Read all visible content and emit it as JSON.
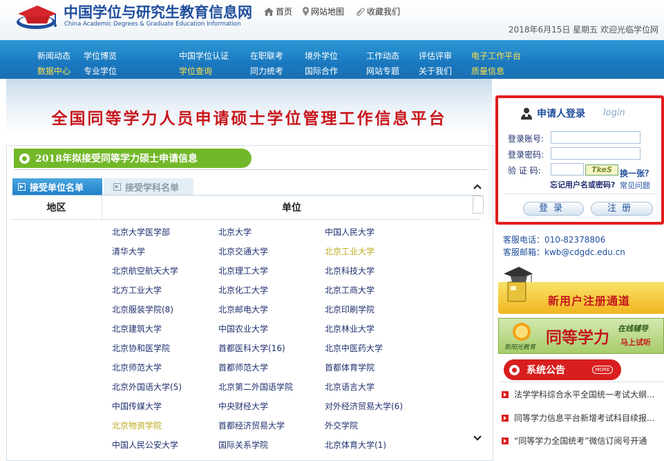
{
  "header": {
    "logo_cn": "中国学位与研究生教育信息网",
    "logo_en": "China Academic Degrees & Graduate Education Information",
    "links": [
      {
        "icon": "home-icon",
        "label": "首页"
      },
      {
        "icon": "location-pin-icon",
        "label": "网站地图"
      },
      {
        "icon": "paperclip-icon",
        "label": "收藏我们"
      }
    ],
    "date_text": "2018年6月15日  星期五  欢迎光临学位网"
  },
  "nav": {
    "row1": [
      "新闻动态",
      "学位博览",
      "中国学位认证",
      "在职联考",
      "境外学位",
      "工作动态",
      "评估评审",
      "电子工作平台"
    ],
    "row2": [
      "数据中心",
      "专业学位",
      "学位查询",
      "同力统考",
      "国际合作",
      "网站专题",
      "关于我们",
      "质量信息"
    ],
    "highlight_color": "#ffe14a"
  },
  "banner": {
    "title": "全国同等学力人员申请硕士学位管理工作信息平台"
  },
  "section": {
    "title": "2018年拟接受同等学力硕士申请信息",
    "tabs": [
      "接受单位名单",
      "接受学科名单"
    ],
    "table_headers": [
      "地区",
      "单位"
    ],
    "rows": [
      [
        {
          "t": "北京大学医学部"
        },
        {
          "t": "北京大学"
        },
        {
          "t": "中国人民大学"
        }
      ],
      [
        {
          "t": "清华大学"
        },
        {
          "t": "北京交通大学"
        },
        {
          "t": "北京工业大学",
          "hl": true
        }
      ],
      [
        {
          "t": "北京航空航天大学"
        },
        {
          "t": "北京理工大学"
        },
        {
          "t": "北京科技大学"
        }
      ],
      [
        {
          "t": "北方工业大学"
        },
        {
          "t": "北京化工大学"
        },
        {
          "t": "北京工商大学"
        }
      ],
      [
        {
          "t": "北京服装学院(8)"
        },
        {
          "t": "北京邮电大学"
        },
        {
          "t": "北京印刷学院"
        }
      ],
      [
        {
          "t": "北京建筑大学"
        },
        {
          "t": "中国农业大学"
        },
        {
          "t": "北京林业大学"
        }
      ],
      [
        {
          "t": "北京协和医学院"
        },
        {
          "t": "首都医科大学(16)"
        },
        {
          "t": "北京中医药大学"
        }
      ],
      [
        {
          "t": "北京师范大学"
        },
        {
          "t": "首都师范大学"
        },
        {
          "t": "首都体育学院"
        }
      ],
      [
        {
          "t": "北京外国语大学(5)"
        },
        {
          "t": "北京第二外国语学院"
        },
        {
          "t": "北京语言大学"
        }
      ],
      [
        {
          "t": "中国传媒大学"
        },
        {
          "t": "中央财经大学"
        },
        {
          "t": "对外经济贸易大学(6)"
        }
      ],
      [
        {
          "t": "北京物资学院",
          "hl": true
        },
        {
          "t": "首都经济贸易大学"
        },
        {
          "t": "外交学院"
        }
      ],
      [
        {
          "t": "中国人民公安大学"
        },
        {
          "t": "国际关系学院"
        },
        {
          "t": "北京体育大学(1)"
        }
      ]
    ]
  },
  "login": {
    "title": "申请人登录",
    "title_en": "login",
    "account_label": "登录账号:",
    "password_label": "登录密码:",
    "captcha_label": "验 证 码:",
    "captcha_text": "TkeS",
    "change_label": "换一张？",
    "forgot_label": "忘记用户名或密码?",
    "faq_label": "常见问题",
    "login_button": "登录",
    "register_button": "注册",
    "border_color": "#e21b1b"
  },
  "service": {
    "phone": "客服电话：010-82378806",
    "email": "客服邮箱：kwb@cdgdc.edu.cn"
  },
  "register_banner": {
    "text": "新用户注册通道"
  },
  "ad": {
    "main": "同等学力",
    "sub1": "在线辅导",
    "sub2": "马上试听",
    "brand": "新阳光教育"
  },
  "announcements": {
    "title": "系统公告",
    "more": "MORE",
    "items": [
      "法学学科综合水平全国统一考试大纲...",
      "同等学力信息平台新增考试科目续报...",
      "“同等学力全国统考”微信订阅号开通"
    ]
  }
}
